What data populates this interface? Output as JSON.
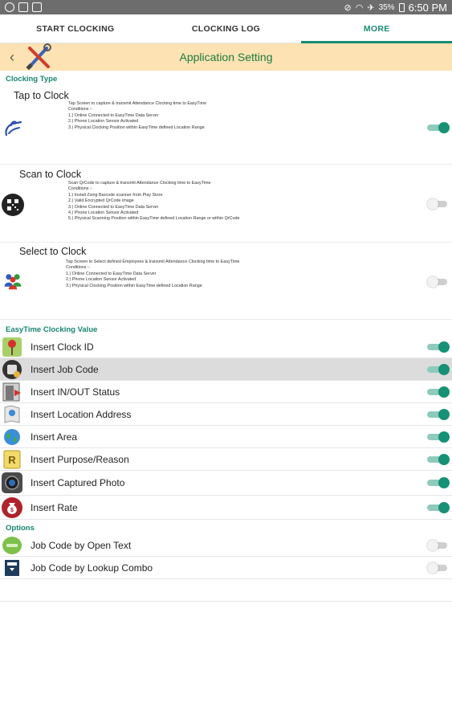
{
  "status": {
    "battery": "35%",
    "time": "6:50 PM"
  },
  "tabs": [
    {
      "label": "START CLOCKING"
    },
    {
      "label": "CLOCKING LOG"
    },
    {
      "label": "MORE"
    }
  ],
  "appbar": {
    "title": "Application Setting"
  },
  "clocking_type": {
    "header": "Clocking Type",
    "items": [
      {
        "title": "Tap to Clock",
        "desc": "Tap Screen to capture & transmit Attendance Clocking time to EasyTime\nConditions :-\n1.) Online Connected to EasyTime Data Server\n2.) Phone Location Sensor Activated\n3.) Physical Clocking Position within EasyTime defined Location Range",
        "enabled": true
      },
      {
        "title": "Scan to Clock",
        "desc": "Scan QrCode to capture & transmit Attendance Clocking time to EasyTime\nConditions :-\n1.) Install Zxing Barcode scanner from Play Store\n2.) Valid Encrypted QrCode image\n3.) Online Connected to EasyTime Data Server\n4.) Phone Location Sensor Activated\n5.) Physical Scanning Position within EasyTime defined Location Range or within QrCode",
        "enabled": false
      },
      {
        "title": "Select to Clock",
        "desc": "Tap Screen to Select defined Employees & transmit Attendance Clocking time to EasyTime\nConditions :-\n1.) Online Connected to EasyTime Data Server\n2.) Phone Location Sensor Activated\n3.) Physical Clocking Position within EasyTime defined Location Range",
        "enabled": false
      }
    ]
  },
  "clocking_value": {
    "header": "EasyTime Clocking Value",
    "items": [
      {
        "label": "Insert Clock ID",
        "enabled": true,
        "icon": "map-pin-icon"
      },
      {
        "label": "Insert Job Code",
        "enabled": true,
        "icon": "job-code-icon"
      },
      {
        "label": "Insert IN/OUT Status",
        "enabled": true,
        "icon": "in-out-status-icon"
      },
      {
        "label": "Insert Location Address",
        "enabled": true,
        "icon": "location-address-icon"
      },
      {
        "label": "Insert Area",
        "enabled": true,
        "icon": "globe-icon"
      },
      {
        "label": "Insert Purpose/Reason",
        "enabled": true,
        "icon": "purpose-icon"
      },
      {
        "label": "Insert Captured Photo",
        "enabled": true,
        "icon": "camera-icon"
      },
      {
        "label": "Insert Rate",
        "enabled": true,
        "icon": "money-bag-icon"
      }
    ]
  },
  "options": {
    "header": "Options",
    "items": [
      {
        "label": "Job Code by Open Text",
        "enabled": false,
        "icon": "open-text-icon"
      },
      {
        "label": "Job Code by Lookup Combo",
        "enabled": false,
        "icon": "lookup-combo-icon"
      }
    ]
  }
}
